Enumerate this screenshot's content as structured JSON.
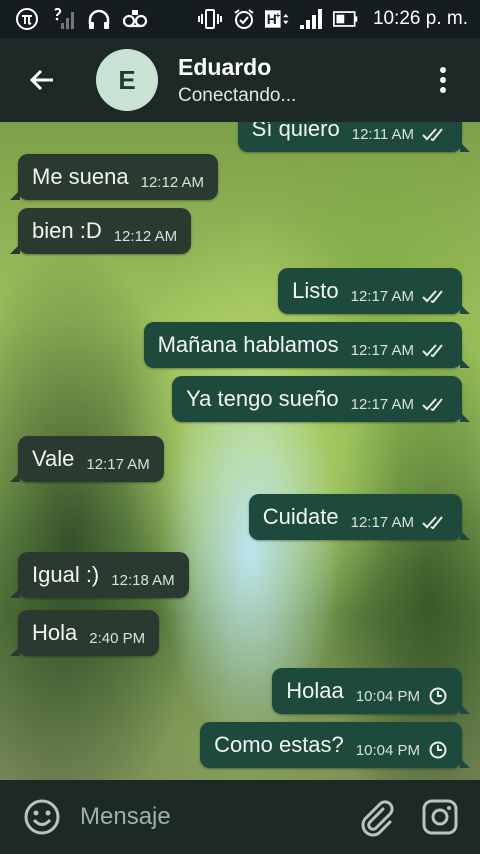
{
  "status_bar": {
    "time": "10:26 p. m.",
    "icons": [
      "pi-icon",
      "signal-question-icon",
      "headset-icon",
      "voicemail-icon",
      "vibrate-icon",
      "alarm-icon",
      "hplus-data-icon",
      "cell-signal-icon",
      "battery-icon"
    ]
  },
  "header": {
    "avatar_letter": "E",
    "contact_name": "Eduardo",
    "status": "Conectando..."
  },
  "messages": [
    {
      "dir": "out",
      "text": "Sí quiero",
      "time": "12:11 AM",
      "status": "read"
    },
    {
      "dir": "in",
      "text": "Me suena",
      "time": "12:12 AM"
    },
    {
      "dir": "in",
      "text": "bien :D",
      "time": "12:12 AM"
    },
    {
      "dir": "out",
      "text": "Listo",
      "time": "12:17 AM",
      "status": "read"
    },
    {
      "dir": "out",
      "text": "Mañana hablamos",
      "time": "12:17 AM",
      "status": "read"
    },
    {
      "dir": "out",
      "text": "Ya tengo sueño",
      "time": "12:17 AM",
      "status": "read"
    },
    {
      "dir": "in",
      "text": "Vale",
      "time": "12:17 AM"
    },
    {
      "dir": "out",
      "text": "Cuidate",
      "time": "12:17 AM",
      "status": "read"
    },
    {
      "dir": "in",
      "text": "Igual :)",
      "time": "12:18 AM"
    },
    {
      "dir": "in",
      "text": "Hola",
      "time": "2:40 PM"
    },
    {
      "dir": "out",
      "text": "Holaa",
      "time": "10:04 PM",
      "status": "pending"
    },
    {
      "dir": "out",
      "text": "Como estas?",
      "time": "10:04 PM",
      "status": "pending"
    }
  ],
  "composer": {
    "placeholder": "Mensaje"
  }
}
